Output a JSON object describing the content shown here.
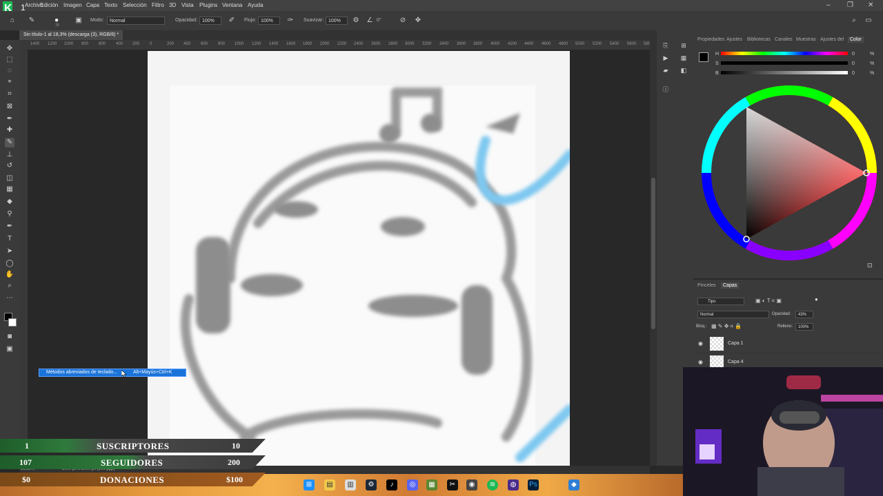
{
  "menubar": {
    "items": [
      "Archivo",
      "Edición",
      "Imagen",
      "Capa",
      "Texto",
      "Selección",
      "Filtro",
      "3D",
      "Vista",
      "Plugins",
      "Ventana",
      "Ayuda"
    ]
  },
  "options": {
    "mode_label": "Modo:",
    "mode_value": "Normal",
    "opacity_label": "Opacidad:",
    "opacity_value": "100%",
    "flow_label": "Flujo:",
    "flow_value": "100%",
    "smoothing_label": "Suavizar:",
    "smoothing_value": "100%",
    "angle_value": "0°",
    "brush_size": "70"
  },
  "document": {
    "tab_title": "Sin título-1 al 18,3% (descarga (3), RGB/8) *"
  },
  "ruler": {
    "ticks": [
      "1400",
      "1200",
      "1000",
      "800",
      "600",
      "400",
      "200",
      "0",
      "200",
      "400",
      "600",
      "800",
      "1000",
      "1200",
      "1400",
      "1600",
      "1800",
      "2000",
      "2200",
      "2400",
      "2600",
      "2800",
      "3000",
      "3200",
      "3400",
      "3600",
      "3800",
      "4000",
      "4200",
      "4400",
      "4600",
      "4800",
      "5000",
      "5200",
      "5400",
      "5600",
      "5800"
    ]
  },
  "tooltip": {
    "label": "Métodos abreviados de teclado...",
    "shortcut": "Alt+Mayús+Ctrl+K"
  },
  "statusbar": {
    "zoom": "18,33%",
    "info": "5000 px x 5000 px (300 ppp)"
  },
  "color_panel": {
    "tabs": [
      "Propiedades",
      "Ajustes",
      "Bibliotecas",
      "Canales",
      "Muestras",
      "Ajustes del",
      "Color"
    ],
    "h_label": "H",
    "s_label": "S",
    "b_label": "B",
    "h_value": "0",
    "s_value": "0",
    "b_value": "0",
    "pct": "%"
  },
  "layers_panel": {
    "tabs": [
      "Pinceles",
      "Capas"
    ],
    "filter_label": "Tipo",
    "blend_mode": "Normal",
    "opacity_label": "Opacidad:",
    "opacity_value": "43%",
    "lock_label": "Bloq.:",
    "fill_label": "Relleno:",
    "fill_value": "100%",
    "layers": [
      {
        "name": "Capa 1"
      },
      {
        "name": "Capa 4"
      }
    ]
  },
  "overlay": {
    "subs": {
      "current": "1",
      "label": "SUSCRIPTORES",
      "goal": "10",
      "color": "#2e7d32"
    },
    "followers": {
      "current": "107",
      "label": "SEGUIDORES",
      "goal": "200",
      "color": "#2e7d32"
    },
    "donations": {
      "current": "$0",
      "label": "DONACIONES",
      "goal": "$100",
      "color": "#e58b2a"
    }
  },
  "taskbar": {
    "icons": [
      "windows-icon",
      "file-explorer-icon",
      "files-icon",
      "steam-icon",
      "tiktok-icon",
      "discord-icon",
      "minecraft-icon",
      "capcut-icon",
      "chrome-icon",
      "spotify-icon",
      "obs-icon",
      "photoshop-icon",
      "vpn-icon"
    ]
  }
}
